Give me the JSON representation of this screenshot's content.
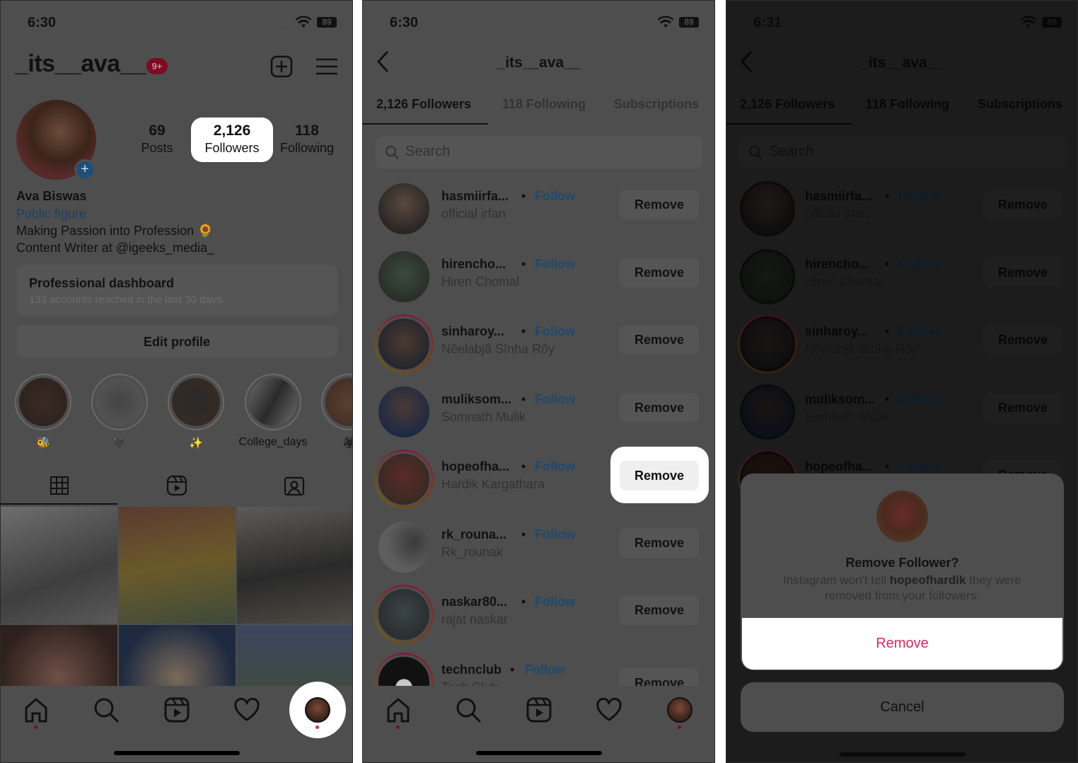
{
  "screens": {
    "profile": {
      "status": {
        "time": "6:30",
        "battery": "89",
        "signal": "...."
      },
      "username": "_its__ava__",
      "notification_badge": "9+",
      "stats": [
        {
          "value": "69",
          "label": "Posts"
        },
        {
          "value": "2,126",
          "label": "Followers"
        },
        {
          "value": "118",
          "label": "Following"
        }
      ],
      "bio": {
        "name": "Ava Biswas",
        "category": "Public figure",
        "line1": "Making Passion into Profession 🌻",
        "line2": "Content Writer at @igeeks_media_"
      },
      "dashboard": {
        "title": "Professional dashboard",
        "subtitle": "133 accounts reached in the last 30 days."
      },
      "edit_profile_label": "Edit profile",
      "highlights": [
        {
          "label": "🐝"
        },
        {
          "label": "🖤"
        },
        {
          "label": "✨"
        },
        {
          "label": "College_days"
        },
        {
          "label": "🏵"
        }
      ],
      "content_tabs": [
        "grid-icon",
        "reels-icon",
        "tagged-icon"
      ],
      "nav": [
        "home-icon",
        "search-icon",
        "reels-icon",
        "heart-icon",
        "profile-avatar"
      ]
    },
    "followers": {
      "status": {
        "time": "6:30",
        "battery": "89",
        "signal": "...."
      },
      "title": "_its__ava__",
      "tabs": [
        "2,126 Followers",
        "118 Following",
        "Subscriptions"
      ],
      "search_placeholder": "Search",
      "follow_label": "Follow",
      "remove_label": "Remove",
      "separator": "•",
      "rows": [
        {
          "username": "hasmiirfa...",
          "name": "official irfan",
          "story": false
        },
        {
          "username": "hirencho...",
          "name": "Hiren Chomal",
          "story": false
        },
        {
          "username": "sinharoy...",
          "name": "Nêelabjâ Sînha Rôy",
          "story": true
        },
        {
          "username": "muliksom...",
          "name": "Somnath Mulik",
          "story": false
        },
        {
          "username": "hopeofha...",
          "name": "Hardik Kargathara",
          "story": true
        },
        {
          "username": "rk_rouna...",
          "name": "Rk_rounak",
          "story": false
        },
        {
          "username": "naskar80...",
          "name": "rajat naskar",
          "story": true
        },
        {
          "username": "technclub",
          "name": "Tech Club",
          "story": true
        }
      ]
    },
    "dialog_screen": {
      "status": {
        "time": "6:31",
        "battery": "89",
        "signal": "...."
      },
      "dialog": {
        "title": "Remove Follower?",
        "message_pre": "Instagram won't tell ",
        "message_user": "hopeofhardik",
        "message_post": " they were removed from your followers.",
        "confirm_label": "Remove",
        "cancel_label": "Cancel"
      }
    }
  },
  "colors": {
    "destructive": "#e0245e",
    "link": "#1d4a70",
    "badge": "#7e0b22"
  }
}
